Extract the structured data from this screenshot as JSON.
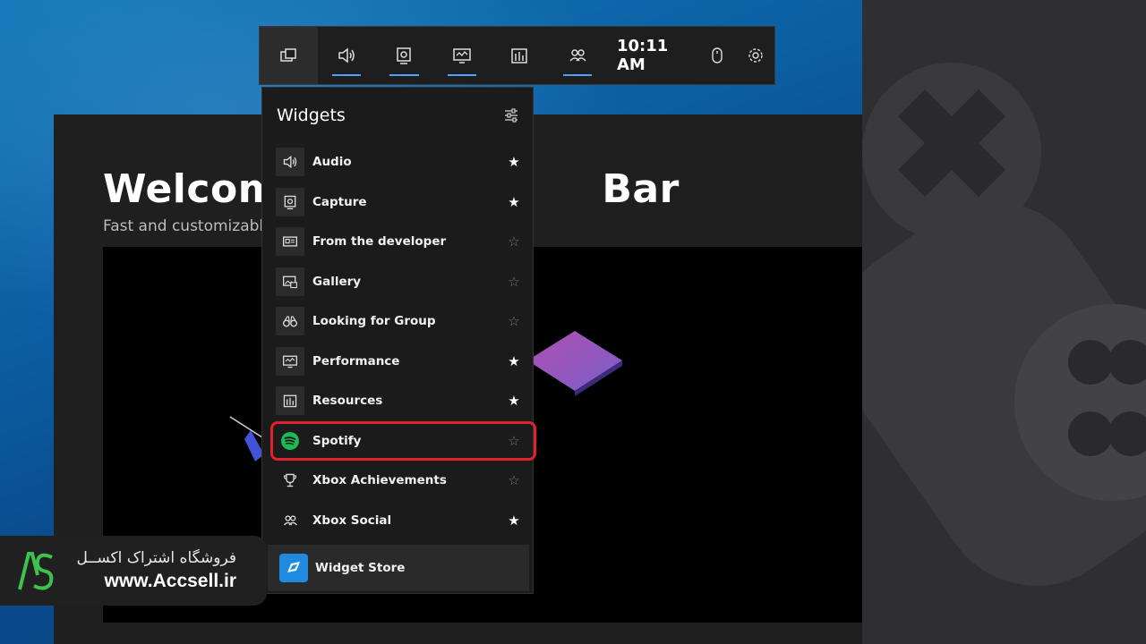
{
  "clock": "10:11 AM",
  "welcome": {
    "title_left": "Welcome",
    "title_right": "Bar",
    "subtitle": "Fast and customizable"
  },
  "widgets_panel": {
    "title": "Widgets",
    "items": [
      {
        "label": "Audio",
        "icon": "speaker-icon",
        "starred": true
      },
      {
        "label": "Capture",
        "icon": "capture-icon",
        "starred": true
      },
      {
        "label": "From the developer",
        "icon": "news-icon",
        "starred": false
      },
      {
        "label": "Gallery",
        "icon": "gallery-icon",
        "starred": false
      },
      {
        "label": "Looking for Group",
        "icon": "binoculars-icon",
        "starred": false
      },
      {
        "label": "Performance",
        "icon": "monitor-icon",
        "starred": true
      },
      {
        "label": "Resources",
        "icon": "resources-icon",
        "starred": true
      },
      {
        "label": "Spotify",
        "icon": "spotify-icon",
        "starred": false,
        "highlighted": true
      },
      {
        "label": "Xbox Achievements",
        "icon": "trophy-icon",
        "starred": false
      },
      {
        "label": "Xbox Social",
        "icon": "people-icon",
        "starred": true
      }
    ],
    "store_label": "Widget Store",
    "star_on": "★",
    "star_off": "☆"
  },
  "watermark": {
    "persian": "فروشگاه اشتراک اکســل",
    "url": "www.Accsell.ir"
  },
  "colors": {
    "accent": "#4aa3ff",
    "highlight": "#e1212b",
    "spotify": "#1db954",
    "logo_green": "#3ec24b"
  }
}
